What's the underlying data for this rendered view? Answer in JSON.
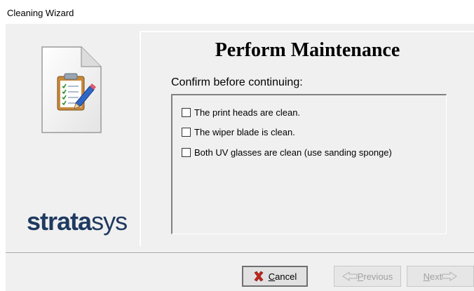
{
  "window": {
    "title": "Cleaning Wizard"
  },
  "sidebar": {
    "logo_bold": "strata",
    "logo_light": "sys"
  },
  "main": {
    "heading": "Perform Maintenance",
    "prompt": "Confirm before continuing:",
    "checklist": [
      {
        "label": "The print heads are clean.",
        "checked": false
      },
      {
        "label": "The wiper blade is clean.",
        "checked": false
      },
      {
        "label": "Both UV glasses are clean (use sanding sponge)",
        "checked": false
      }
    ]
  },
  "buttons": {
    "cancel": {
      "accel": "C",
      "rest": "ancel",
      "icon": "red-x-icon"
    },
    "previous": {
      "accel": "P",
      "rest": "revious",
      "enabled": false
    },
    "next": {
      "accel": "N",
      "rest": "ext",
      "enabled": false
    }
  },
  "colors": {
    "cancel_icon": "#c0281c",
    "logo": "#1f3a60"
  }
}
